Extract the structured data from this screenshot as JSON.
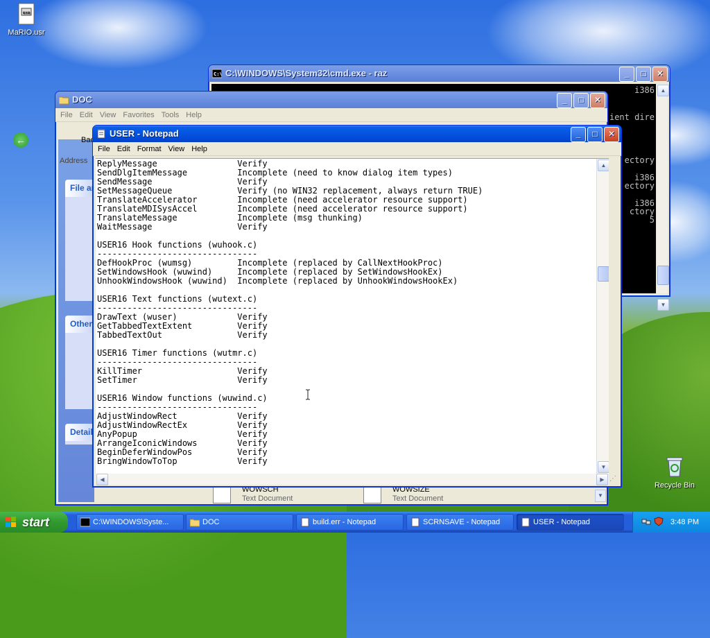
{
  "desktop": {
    "icons": [
      {
        "label": "MaRIO.usr"
      },
      {
        "label": "Recycle Bin"
      }
    ]
  },
  "cmd_window": {
    "title": "C:\\WINDOWS\\System32\\cmd.exe - raz",
    "console_lines": [
      "i386",
      "ient dire",
      "ectory",
      "i386",
      "ectory",
      "i386",
      "ctory",
      "5"
    ]
  },
  "explorer_window": {
    "title": "DOC",
    "menu": [
      "File",
      "Edit",
      "View",
      "Favorites",
      "Tools",
      "Help"
    ],
    "back_label": "Back",
    "address_label": "Address",
    "panels": {
      "file_tasks": "File and Folder Tasks",
      "other_places": "Other Places",
      "details": "Details"
    },
    "files": [
      {
        "name": "WOWSCH",
        "type": "Text Document"
      },
      {
        "name": "WOWSIZE",
        "type": "Text Document"
      }
    ]
  },
  "notepad": {
    "title": "USER - Notepad",
    "menu": [
      "File",
      "Edit",
      "Format",
      "View",
      "Help"
    ],
    "lines": [
      "ReplyMessage                Verify",
      "SendDlgItemMessage          Incomplete (need to know dialog item types)",
      "SendMessage                 Verify",
      "SetMessageQueue             Verify (no WIN32 replacement, always return TRUE)",
      "TranslateAccelerator        Incomplete (need accelerator resource support)",
      "TranslateMDISysAccel        Incomplete (need accelerator resource support)",
      "TranslateMessage            Incomplete (msg thunking)",
      "WaitMessage                 Verify",
      "",
      "USER16 Hook functions (wuhook.c)",
      "--------------------------------",
      "DefHookProc (wumsg)         Incomplete (replaced by CallNextHookProc)",
      "SetWindowsHook (wuwind)     Incomplete (replaced by SetWindowsHookEx)",
      "UnhookWindowsHook (wuwind)  Incomplete (replaced by UnhookWindowsHookEx)",
      "",
      "USER16 Text functions (wutext.c)",
      "--------------------------------",
      "DrawText (wuser)            Verify",
      "GetTabbedTextExtent         Verify",
      "TabbedTextOut               Verify",
      "",
      "USER16 Timer functions (wutmr.c)",
      "--------------------------------",
      "KillTimer                   Verify",
      "SetTimer                    Verify",
      "",
      "USER16 Window functions (wuwind.c)",
      "--------------------------------",
      "AdjustWindowRect            Verify",
      "AdjustWindowRectEx          Verify",
      "AnyPopup                    Verify",
      "ArrangeIconicWindows        Verify",
      "BeginDeferWindowPos         Verify",
      "BringWindowToTop            Verify"
    ]
  },
  "taskbar": {
    "start_label": "start",
    "tasks": [
      {
        "label": "C:\\WINDOWS\\Syste..."
      },
      {
        "label": "DOC"
      },
      {
        "label": "build.err - Notepad"
      },
      {
        "label": "SCRNSAVE - Notepad"
      },
      {
        "label": "USER - Notepad"
      }
    ],
    "clock": "3:48 PM"
  }
}
